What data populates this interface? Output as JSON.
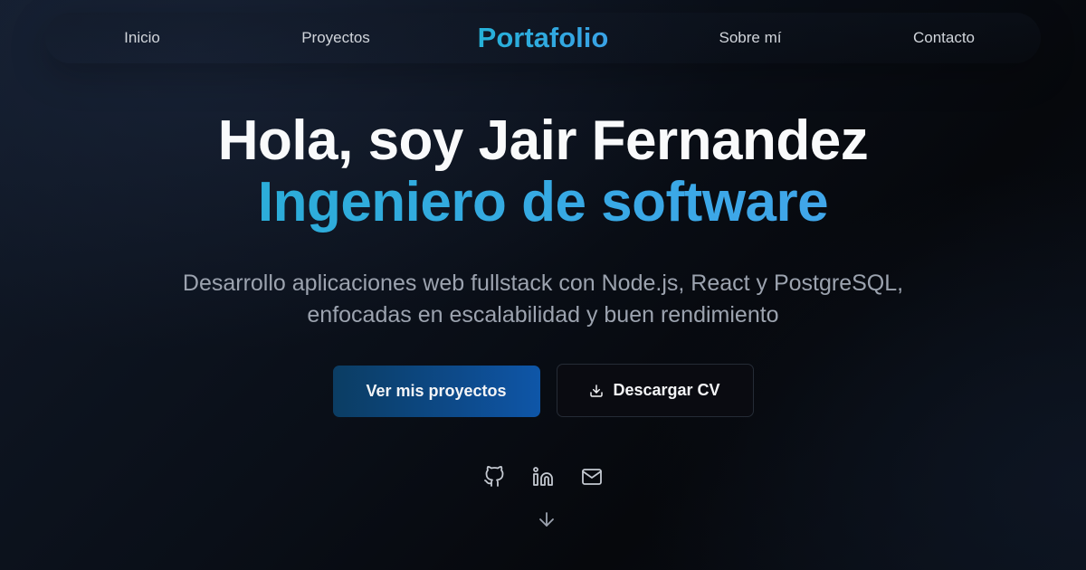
{
  "nav": {
    "items": [
      {
        "label": "Inicio"
      },
      {
        "label": "Proyectos"
      },
      {
        "label": "Sobre mí"
      },
      {
        "label": "Contacto"
      }
    ],
    "brand": "Portafolio"
  },
  "hero": {
    "title_line1": "Hola, soy Jair Fernandez",
    "title_line2": "Ingeniero de software",
    "description": "Desarrollo aplicaciones web fullstack con Node.js, React y PostgreSQL, enfocadas en escalabilidad y buen rendimiento"
  },
  "actions": {
    "primary_label": "Ver mis proyectos",
    "secondary_label": "Descargar CV",
    "secondary_icon": "download-icon"
  },
  "socials": [
    {
      "icon": "github-icon"
    },
    {
      "icon": "linkedin-icon"
    },
    {
      "icon": "mail-icon"
    }
  ],
  "scroll_icon": "arrow-down-icon",
  "colors": {
    "accent": "#2ba9e0",
    "background": "#0a0f18",
    "muted_text": "#9ca3af"
  }
}
